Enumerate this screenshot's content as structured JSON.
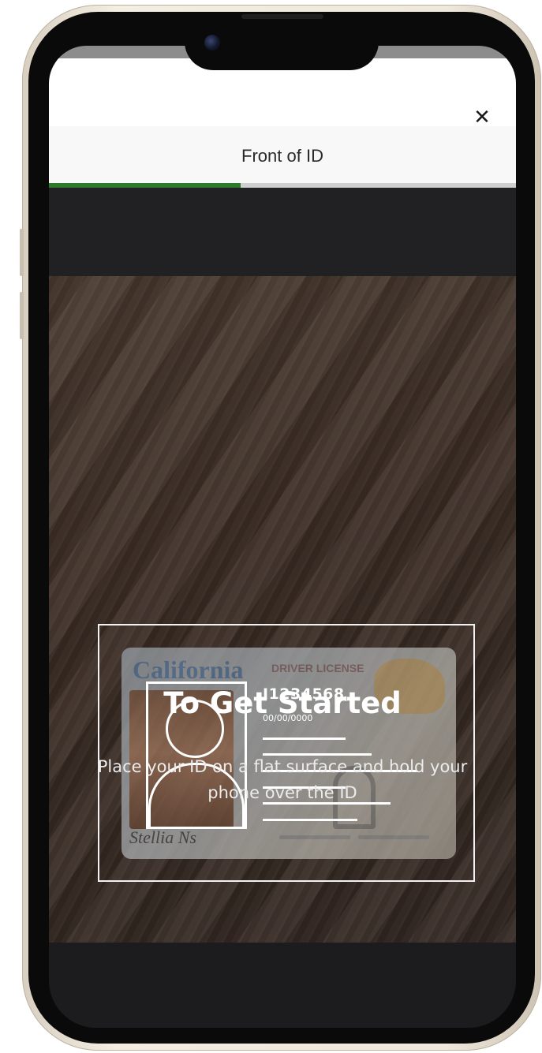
{
  "header": {
    "title": "Front of ID",
    "close_icon": "close-icon",
    "close_glyph": "✕"
  },
  "progress": {
    "fraction": 0.41,
    "fill_color": "#2e7a2a"
  },
  "id_illustration": {
    "card_state": "California",
    "card_type": "DRIVER LICENSE",
    "id_number": "I1234568",
    "date": "00/00/0000",
    "photo_placeholder_icon": "person-silhouette-icon"
  },
  "main": {
    "heading": "To Get Started",
    "subtitle": "Place your ID on a flat surface and hold your phone over the ID"
  }
}
